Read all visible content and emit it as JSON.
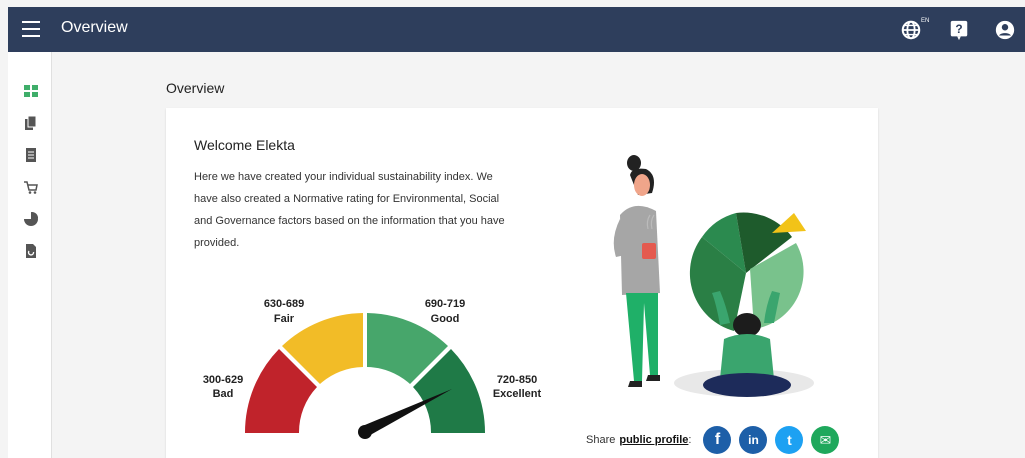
{
  "header": {
    "title": "Overview",
    "lang_badge": "EN"
  },
  "page": {
    "title": "Overview"
  },
  "card": {
    "welcome": "Welcome Elekta",
    "intro": "Here we have created your individual sustainability index. We have also created a Normative rating for Environmental, Social and Governance factors based on the information that you have provided."
  },
  "gauge": {
    "bands": [
      {
        "range": "300-629",
        "label": "Bad",
        "color": "#c0232b"
      },
      {
        "range": "630-689",
        "label": "Fair",
        "color": "#f2bc27"
      },
      {
        "range": "690-719",
        "label": "Good",
        "color": "#47a66b"
      },
      {
        "range": "720-850",
        "label": "Excellent",
        "color": "#1f7a47"
      }
    ]
  },
  "share": {
    "prefix": "Share ",
    "link": "public profile",
    "suffix": ":",
    "icons": [
      {
        "name": "facebook-icon",
        "color": "#1d5fa8",
        "glyph": "f"
      },
      {
        "name": "linkedin-icon",
        "color": "#1d5fa8",
        "glyph": "in"
      },
      {
        "name": "twitter-icon",
        "color": "#1da1f2",
        "glyph": "t"
      },
      {
        "name": "email-icon",
        "color": "#1fa85c",
        "glyph": "✉"
      }
    ]
  },
  "colors": {
    "header_bg": "#2e3e5c",
    "accent": "#3fae6a"
  }
}
